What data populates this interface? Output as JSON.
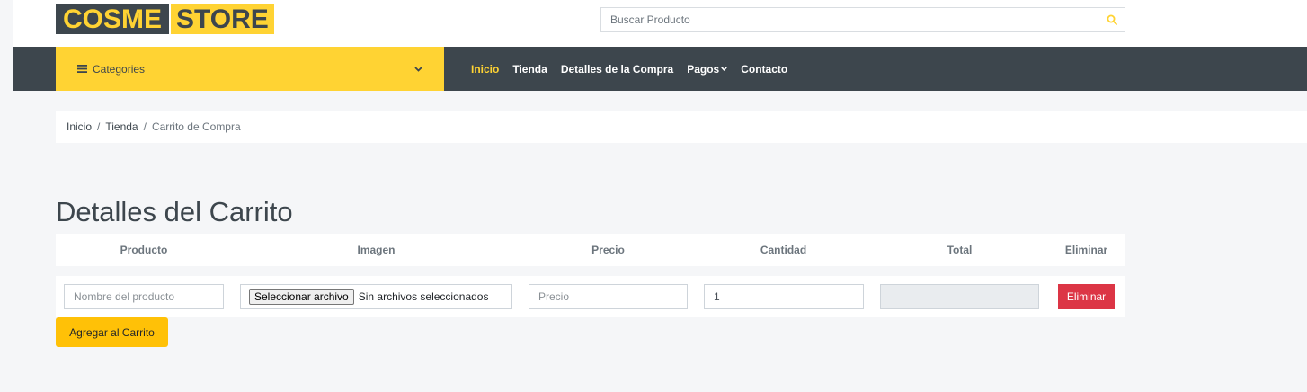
{
  "logo": {
    "part1": "COSME",
    "part2": "STORE"
  },
  "search": {
    "placeholder": "Buscar Producto",
    "button_icon": "search-icon"
  },
  "categories": {
    "label": "Categories",
    "icon": "bars-icon",
    "chevron": "chevron-down-icon"
  },
  "nav": {
    "items": [
      "Inicio",
      "Tienda",
      "Detalles de la Compra",
      "Pagos",
      "Contacto"
    ],
    "active_index": 0
  },
  "breadcrumb": {
    "items": [
      "Inicio",
      "Tienda",
      "Carrito de Compra"
    ],
    "separator": "/"
  },
  "page_title": "Detalles del Carrito",
  "table": {
    "headers": [
      "Producto",
      "Imagen",
      "Precio",
      "Cantidad",
      "Total",
      "Eliminar"
    ],
    "row": {
      "product_placeholder": "Nombre del producto",
      "file_button": "Seleccionar archivo",
      "file_status": "Sin archivos seleccionados",
      "price_placeholder": "Precio",
      "quantity_value": "1",
      "total_value": "",
      "delete_label": "Eliminar"
    }
  },
  "add_to_cart_label": "Agregar al Carrito",
  "colors": {
    "primary": "#ffd333",
    "dark": "#3d464d",
    "danger": "#dc3545",
    "warning": "#ffc107",
    "background": "#f5f6f8"
  }
}
